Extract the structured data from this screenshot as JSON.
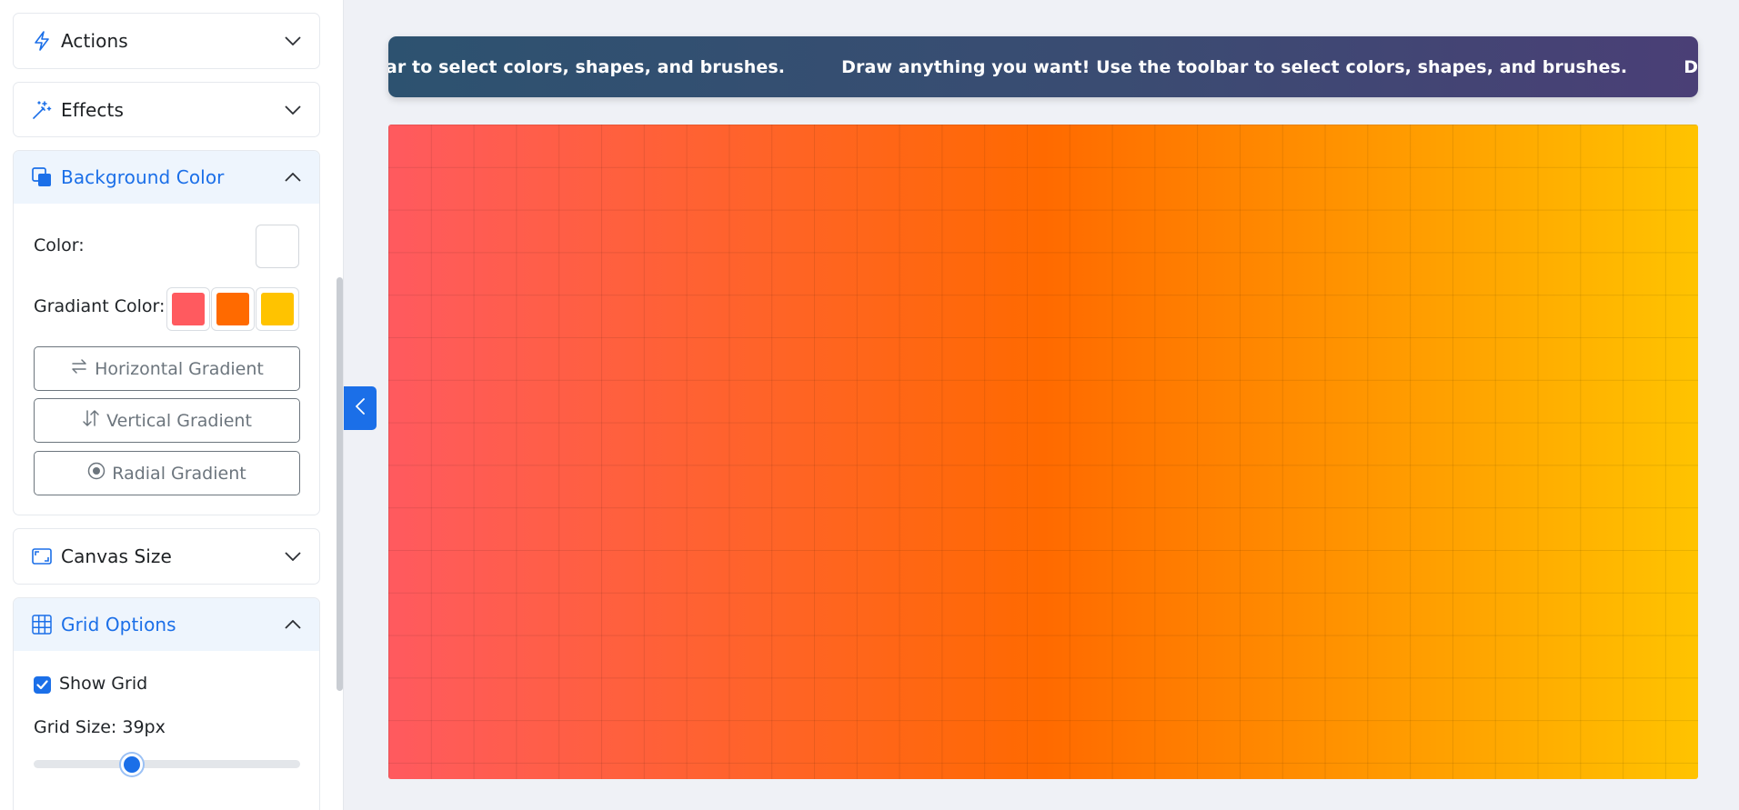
{
  "sidebar": {
    "panels": {
      "actions": {
        "title": "Actions",
        "icon": "lightning-icon",
        "open": false
      },
      "effects": {
        "title": "Effects",
        "icon": "magic-wand-icon",
        "open": false
      },
      "background": {
        "title": "Background Color",
        "icon": "layers-icon",
        "open": true,
        "color_label": "Color:",
        "color_value": "#ffffff",
        "gradient_label": "Gradiant Color:",
        "gradient_colors": [
          "#ff5a5f",
          "#ff6a00",
          "#ffc300"
        ],
        "buttons": {
          "horizontal": "Horizontal Gradient",
          "vertical": "Vertical Gradient",
          "radial": "Radial Gradient"
        }
      },
      "canvas_size": {
        "title": "Canvas Size",
        "icon": "aspect-ratio-icon",
        "open": false
      },
      "grid": {
        "title": "Grid Options",
        "icon": "grid-icon",
        "open": true,
        "show_grid_label": "Show Grid",
        "show_grid": true,
        "size_label": "Grid Size: 39px",
        "size_value": 39
      }
    }
  },
  "banner": {
    "message": "Draw anything you want! Use the toolbar to select colors, shapes, and brushes."
  },
  "canvas": {
    "gradient": [
      "#ff5a5f",
      "#ff6a00",
      "#ffc300"
    ],
    "gradient_type": "horizontal",
    "grid_visible": true
  },
  "colors": {
    "accent": "#1b6fe8"
  }
}
